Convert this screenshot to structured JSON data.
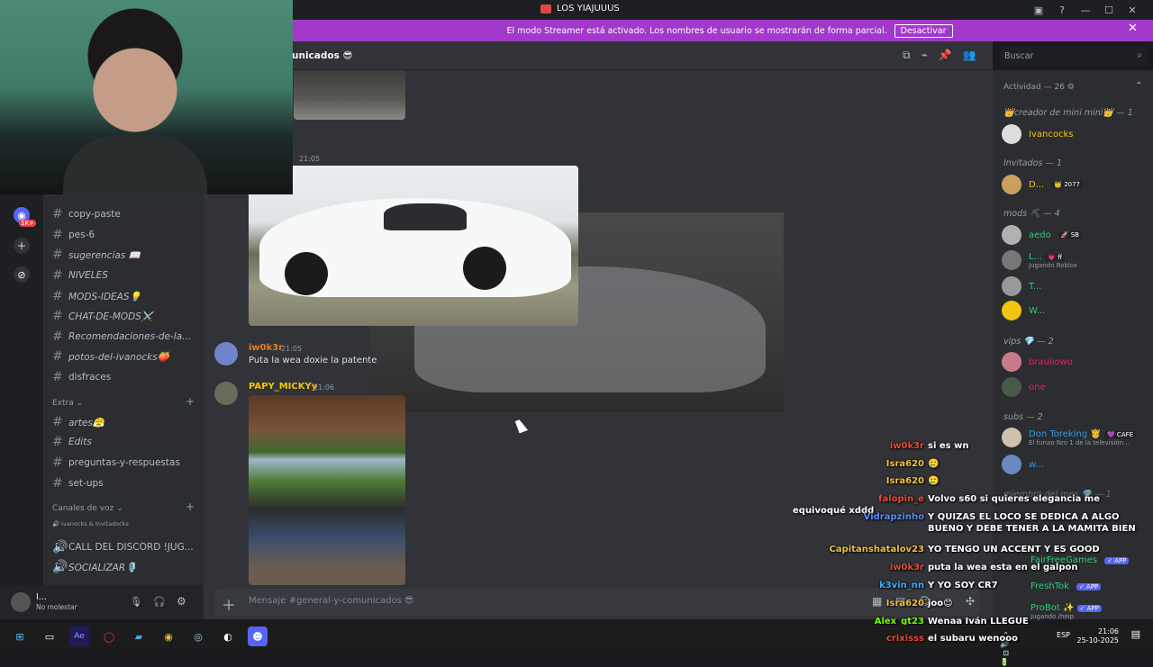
{
  "window": {
    "title": "LOS YIAJUUUS"
  },
  "streamer_bar": {
    "text": "El modo Streamer está activado. Los nombres de usuario se mostrarán de forma parcial.",
    "button": "Desactivar"
  },
  "channel": {
    "name": "unicados 😎",
    "search_placeholder": "Buscar",
    "composer_placeholder": "Mensaje #general-y-comunicados 😎"
  },
  "servers": {
    "badge": "1K+"
  },
  "channels": [
    {
      "name": "copy-paste"
    },
    {
      "name": "pes-6"
    },
    {
      "name": "sugerencias 📖"
    },
    {
      "name": "NIVELES"
    },
    {
      "name": "MODS-IDEAS💡"
    },
    {
      "name": "CHAT-DE-MODS⚔️"
    },
    {
      "name": "Recomendaciones-de-la..."
    },
    {
      "name": "potos-del-ivanocks🍑"
    },
    {
      "name": "disfraces"
    }
  ],
  "extra": {
    "category": "Extra",
    "items": [
      {
        "name": "artes😤"
      },
      {
        "name": "Edits"
      },
      {
        "name": "preguntas-y-respuestas"
      },
      {
        "name": "set-ups"
      }
    ]
  },
  "voice": {
    "category": "Canales de voz",
    "users": "ivanocks & Invitadocks",
    "items": [
      {
        "name": "CALL DEL DISCORD !JUG..."
      },
      {
        "name": "SOCIALIZAR🎙️"
      }
    ]
  },
  "user": {
    "name": "I...",
    "status": "No molestar"
  },
  "messages": [
    {
      "time": "21:05"
    },
    {
      "user": "iw0k3r",
      "time": "21:05",
      "text": "Puta la wea doxie la patente",
      "color": "#e67e22"
    },
    {
      "user": "PAPY_MICKYy",
      "time": "21:06",
      "color": "#f1c40f"
    }
  ],
  "members": {
    "activity": "Actividad — 26 ⚙",
    "groups": [
      {
        "title": "👑creador de mini mini👑 — 1",
        "members": [
          {
            "name": "Ivancocks",
            "color": "#f1c40f"
          }
        ]
      },
      {
        "title": "Invitados — 1",
        "members": [
          {
            "name": "D...",
            "tag": "👑 2077",
            "color": "#f1c40f"
          }
        ]
      },
      {
        "title": "mods ⛏ — 4",
        "members": [
          {
            "name": "aedo",
            "tag": "🚀 SB",
            "color": "#2ecc71"
          },
          {
            "name": "L...",
            "tag": "💗 ff",
            "sub": "Jugando Roblox",
            "color": "#2ecc71"
          },
          {
            "name": "T...",
            "color": "#2ecc71"
          },
          {
            "name": "W...",
            "color": "#2ecc71"
          }
        ]
      },
      {
        "title": "vips 💎 — 2",
        "members": [
          {
            "name": "brauliowo",
            "color": "#e91e63"
          },
          {
            "name": "one",
            "color": "#e91e63"
          }
        ]
      },
      {
        "title": "subs — 2",
        "members": [
          {
            "name": "Don Toreking 🤴",
            "tag": "💜 CAFE",
            "sub": "El funao Nro 1 de la televisión...",
            "color": "#3498db"
          },
          {
            "name": "w...",
            "color": "#3498db"
          }
        ]
      }
    ],
    "bots": [
      {
        "name": "FairFreeGames",
        "badge": "✓ APP"
      },
      {
        "name": "FreshTok",
        "badge": "✓ APP"
      },
      {
        "name": "ProBot ✨",
        "badge": "✓ APP",
        "sub": "Jugando /help"
      }
    ],
    "hidden_group": "miembro del mes 💎 — 1"
  },
  "chat_overlay": [
    {
      "user": "iw0k3r",
      "msg": "si es wn",
      "color": "#e74c3c"
    },
    {
      "user": "Isra620",
      "msg": "🥲",
      "color": "#f0c040"
    },
    {
      "user": "Isra620",
      "msg": "🥲",
      "color": "#f0c040"
    },
    {
      "user": "falopin_e",
      "msg": "Volvo s60 si quieres elegancia me equivoqué xddd",
      "color": "#e74c3c"
    },
    {
      "user": "Vidrapzinho",
      "msg": "Y QUIZAS EL LOCO SE DEDICA A ALGO BUENO Y DEBE TENER A LA MAMITA BIEN",
      "color": "#5b8cff"
    },
    {
      "user": "Capitanshatalov23",
      "msg": "YO TENGO UN ACCENT Y ES GOOD",
      "color": "#f0c040"
    },
    {
      "user": "iw0k3r",
      "msg": "puta la wea esta en el galpon",
      "color": "#e74c3c"
    },
    {
      "user": "k3vin_nn",
      "msg": "Y YO SOY CR7",
      "color": "#3db0ff"
    },
    {
      "user": "Isra620",
      "msg": "joo😊",
      "color": "#f0c040"
    },
    {
      "user": "Alex_gt23",
      "msg": "Wenaa Iván LLEGUE",
      "color": "#7cfc00"
    },
    {
      "user": "crixisss",
      "msg": "el subaru wenooo",
      "color": "#e74c3c"
    }
  ],
  "taskbar": {
    "lang": "ESP",
    "time": "21:06",
    "date": "25-10-2025"
  }
}
